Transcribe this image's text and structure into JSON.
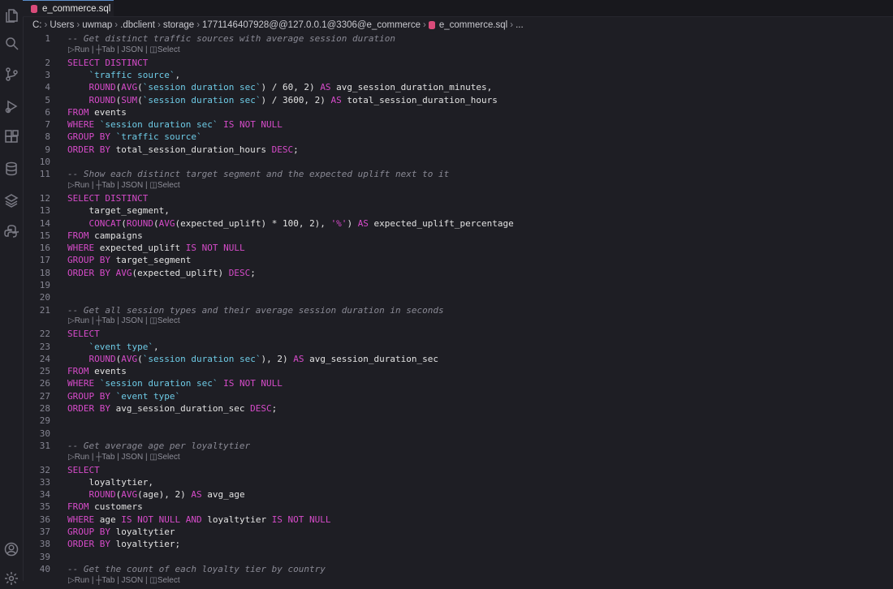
{
  "tab": {
    "title": "e_commerce.sql",
    "close_label": "×"
  },
  "breadcrumb": {
    "items": [
      "C:",
      "Users",
      "uwmap",
      ".dbclient",
      "storage",
      "1771146407928@@127.0.0.1@3306@e_commerce",
      "e_commerce.sql",
      "..."
    ]
  },
  "codelens": "▷Run | ┼Tab | JSON | ◫Select",
  "activity_icons": [
    "files-icon",
    "search-icon",
    "source-control-icon",
    "run-debug-icon",
    "extensions-icon",
    "database-icon",
    "layers-icon",
    "python-icon",
    "account-icon",
    "settings-icon"
  ],
  "lines": [
    {
      "n": "1",
      "tokens": [
        [
          "cm",
          "-- Get distinct traffic sources with average session duration"
        ]
      ]
    },
    {
      "lens": true
    },
    {
      "n": "2",
      "tokens": [
        [
          "kw",
          "SELECT DISTINCT"
        ]
      ]
    },
    {
      "n": "3",
      "tokens": [
        [
          "id",
          "    "
        ],
        [
          "bt",
          "`traffic source`"
        ],
        [
          "id",
          ","
        ]
      ]
    },
    {
      "n": "4",
      "tokens": [
        [
          "id",
          "    "
        ],
        [
          "fn",
          "ROUND"
        ],
        [
          "id",
          "("
        ],
        [
          "fn",
          "AVG"
        ],
        [
          "id",
          "("
        ],
        [
          "bt",
          "`session duration sec`"
        ],
        [
          "id",
          ") / 60, 2) "
        ],
        [
          "kw",
          "AS"
        ],
        [
          "id",
          " avg_session_duration_minutes,"
        ]
      ]
    },
    {
      "n": "5",
      "tokens": [
        [
          "id",
          "    "
        ],
        [
          "fn",
          "ROUND"
        ],
        [
          "id",
          "("
        ],
        [
          "fn",
          "SUM"
        ],
        [
          "id",
          "("
        ],
        [
          "bt",
          "`session duration sec`"
        ],
        [
          "id",
          ") / 3600, 2) "
        ],
        [
          "kw",
          "AS"
        ],
        [
          "id",
          " total_session_duration_hours"
        ]
      ]
    },
    {
      "n": "6",
      "tokens": [
        [
          "kw",
          "FROM"
        ],
        [
          "id",
          " events"
        ]
      ]
    },
    {
      "n": "7",
      "tokens": [
        [
          "kw",
          "WHERE"
        ],
        [
          "id",
          " "
        ],
        [
          "bt",
          "`session duration sec`"
        ],
        [
          "id",
          " "
        ],
        [
          "kw",
          "IS NOT NULL"
        ]
      ]
    },
    {
      "n": "8",
      "tokens": [
        [
          "kw",
          "GROUP BY"
        ],
        [
          "id",
          " "
        ],
        [
          "bt",
          "`traffic source`"
        ]
      ]
    },
    {
      "n": "9",
      "tokens": [
        [
          "kw",
          "ORDER BY"
        ],
        [
          "id",
          " total_session_duration_hours "
        ],
        [
          "kw",
          "DESC"
        ],
        [
          "id",
          ";"
        ]
      ]
    },
    {
      "n": "10",
      "tokens": []
    },
    {
      "n": "11",
      "tokens": [
        [
          "cm",
          "-- Show each distinct target segment and the expected uplift next to it"
        ]
      ]
    },
    {
      "lens": true
    },
    {
      "n": "12",
      "tokens": [
        [
          "kw",
          "SELECT DISTINCT"
        ]
      ]
    },
    {
      "n": "13",
      "tokens": [
        [
          "id",
          "    target_segment,"
        ]
      ]
    },
    {
      "n": "14",
      "tokens": [
        [
          "id",
          "    "
        ],
        [
          "fn",
          "CONCAT"
        ],
        [
          "id",
          "("
        ],
        [
          "fn",
          "ROUND"
        ],
        [
          "id",
          "("
        ],
        [
          "fn",
          "AVG"
        ],
        [
          "id",
          "(expected_uplift) * 100, 2), "
        ],
        [
          "str",
          "'%'"
        ],
        [
          "id",
          ") "
        ],
        [
          "kw",
          "AS"
        ],
        [
          "id",
          " expected_uplift_percentage"
        ]
      ]
    },
    {
      "n": "15",
      "tokens": [
        [
          "kw",
          "FROM"
        ],
        [
          "id",
          " campaigns"
        ]
      ]
    },
    {
      "n": "16",
      "tokens": [
        [
          "kw",
          "WHERE"
        ],
        [
          "id",
          " expected_uplift "
        ],
        [
          "kw",
          "IS NOT NULL"
        ]
      ]
    },
    {
      "n": "17",
      "tokens": [
        [
          "kw",
          "GROUP BY"
        ],
        [
          "id",
          " target_segment"
        ]
      ]
    },
    {
      "n": "18",
      "tokens": [
        [
          "kw",
          "ORDER BY"
        ],
        [
          "id",
          " "
        ],
        [
          "fn",
          "AVG"
        ],
        [
          "id",
          "(expected_uplift) "
        ],
        [
          "kw",
          "DESC"
        ],
        [
          "id",
          ";"
        ]
      ]
    },
    {
      "n": "19",
      "tokens": []
    },
    {
      "n": "20",
      "tokens": []
    },
    {
      "n": "21",
      "tokens": [
        [
          "cm",
          "-- Get all session types and their average session duration in seconds"
        ]
      ]
    },
    {
      "lens": true
    },
    {
      "n": "22",
      "tokens": [
        [
          "kw",
          "SELECT"
        ]
      ]
    },
    {
      "n": "23",
      "tokens": [
        [
          "id",
          "    "
        ],
        [
          "bt",
          "`event type`"
        ],
        [
          "id",
          ","
        ]
      ]
    },
    {
      "n": "24",
      "tokens": [
        [
          "id",
          "    "
        ],
        [
          "fn",
          "ROUND"
        ],
        [
          "id",
          "("
        ],
        [
          "fn",
          "AVG"
        ],
        [
          "id",
          "("
        ],
        [
          "bt",
          "`session duration sec`"
        ],
        [
          "id",
          "), 2) "
        ],
        [
          "kw",
          "AS"
        ],
        [
          "id",
          " avg_session_duration_sec"
        ]
      ]
    },
    {
      "n": "25",
      "tokens": [
        [
          "kw",
          "FROM"
        ],
        [
          "id",
          " events"
        ]
      ]
    },
    {
      "n": "26",
      "tokens": [
        [
          "kw",
          "WHERE"
        ],
        [
          "id",
          " "
        ],
        [
          "bt",
          "`session duration sec`"
        ],
        [
          "id",
          " "
        ],
        [
          "kw",
          "IS NOT NULL"
        ]
      ]
    },
    {
      "n": "27",
      "tokens": [
        [
          "kw",
          "GROUP BY"
        ],
        [
          "id",
          " "
        ],
        [
          "bt",
          "`event type`"
        ]
      ]
    },
    {
      "n": "28",
      "tokens": [
        [
          "kw",
          "ORDER BY"
        ],
        [
          "id",
          " avg_session_duration_sec "
        ],
        [
          "kw",
          "DESC"
        ],
        [
          "id",
          ";"
        ]
      ]
    },
    {
      "n": "29",
      "tokens": []
    },
    {
      "n": "30",
      "tokens": []
    },
    {
      "n": "31",
      "tokens": [
        [
          "cm",
          "-- Get average age per loyaltytier"
        ]
      ]
    },
    {
      "lens": true
    },
    {
      "n": "32",
      "tokens": [
        [
          "kw",
          "SELECT"
        ]
      ]
    },
    {
      "n": "33",
      "tokens": [
        [
          "id",
          "    loyaltytier,"
        ]
      ]
    },
    {
      "n": "34",
      "tokens": [
        [
          "id",
          "    "
        ],
        [
          "fn",
          "ROUND"
        ],
        [
          "id",
          "("
        ],
        [
          "fn",
          "AVG"
        ],
        [
          "id",
          "(age), 2) "
        ],
        [
          "kw",
          "AS"
        ],
        [
          "id",
          " avg_age"
        ]
      ]
    },
    {
      "n": "35",
      "tokens": [
        [
          "kw",
          "FROM"
        ],
        [
          "id",
          " customers"
        ]
      ]
    },
    {
      "n": "36",
      "tokens": [
        [
          "kw",
          "WHERE"
        ],
        [
          "id",
          " age "
        ],
        [
          "kw",
          "IS NOT NULL AND"
        ],
        [
          "id",
          " loyaltytier "
        ],
        [
          "kw",
          "IS NOT NULL"
        ]
      ]
    },
    {
      "n": "37",
      "tokens": [
        [
          "kw",
          "GROUP BY"
        ],
        [
          "id",
          " loyaltytier"
        ]
      ]
    },
    {
      "n": "38",
      "tokens": [
        [
          "kw",
          "ORDER BY"
        ],
        [
          "id",
          " loyaltytier;"
        ]
      ]
    },
    {
      "n": "39",
      "tokens": []
    },
    {
      "n": "40",
      "tokens": [
        [
          "cm",
          "-- Get the count of each loyalty tier by country"
        ]
      ]
    },
    {
      "lens": true
    }
  ]
}
